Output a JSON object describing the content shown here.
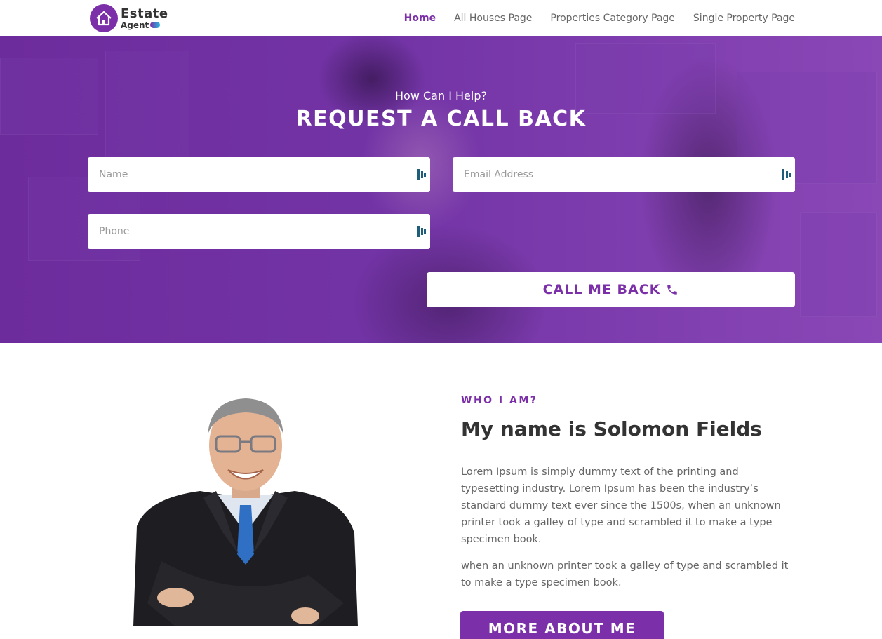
{
  "header": {
    "logo": {
      "line1": "Estate",
      "line2": "Agent"
    },
    "nav": [
      {
        "label": "Home",
        "active": true
      },
      {
        "label": "All Houses Page",
        "active": false
      },
      {
        "label": "Properties Category Page",
        "active": false
      },
      {
        "label": "Single Property Page",
        "active": false
      }
    ]
  },
  "hero": {
    "subtitle": "How Can I Help?",
    "title": "REQUEST A CALL BACK",
    "form": {
      "name_placeholder": "Name",
      "email_placeholder": "Email Address",
      "phone_placeholder": "Phone",
      "submit_label": "CALL ME BACK",
      "submit_icon": "phone-icon"
    }
  },
  "about": {
    "eyebrow": "WHO I AM?",
    "title": "My name is Solomon Fields",
    "paragraph1": "Lorem Ipsum is simply dummy text of the printing and typesetting industry. Lorem Ipsum has been the industry’s standard dummy text ever since the 1500s, when an unknown printer took a galley of type and scrambled it to make a type specimen book.",
    "paragraph2": "when an unknown printer took a galley of type and scrambled it to make a type specimen book.",
    "button_label": "MORE ABOUT ME"
  },
  "colors": {
    "accent": "#7b2fa8",
    "hero_overlay": "#6d2c9c",
    "text_dark": "#333333",
    "text_body": "#666666"
  }
}
